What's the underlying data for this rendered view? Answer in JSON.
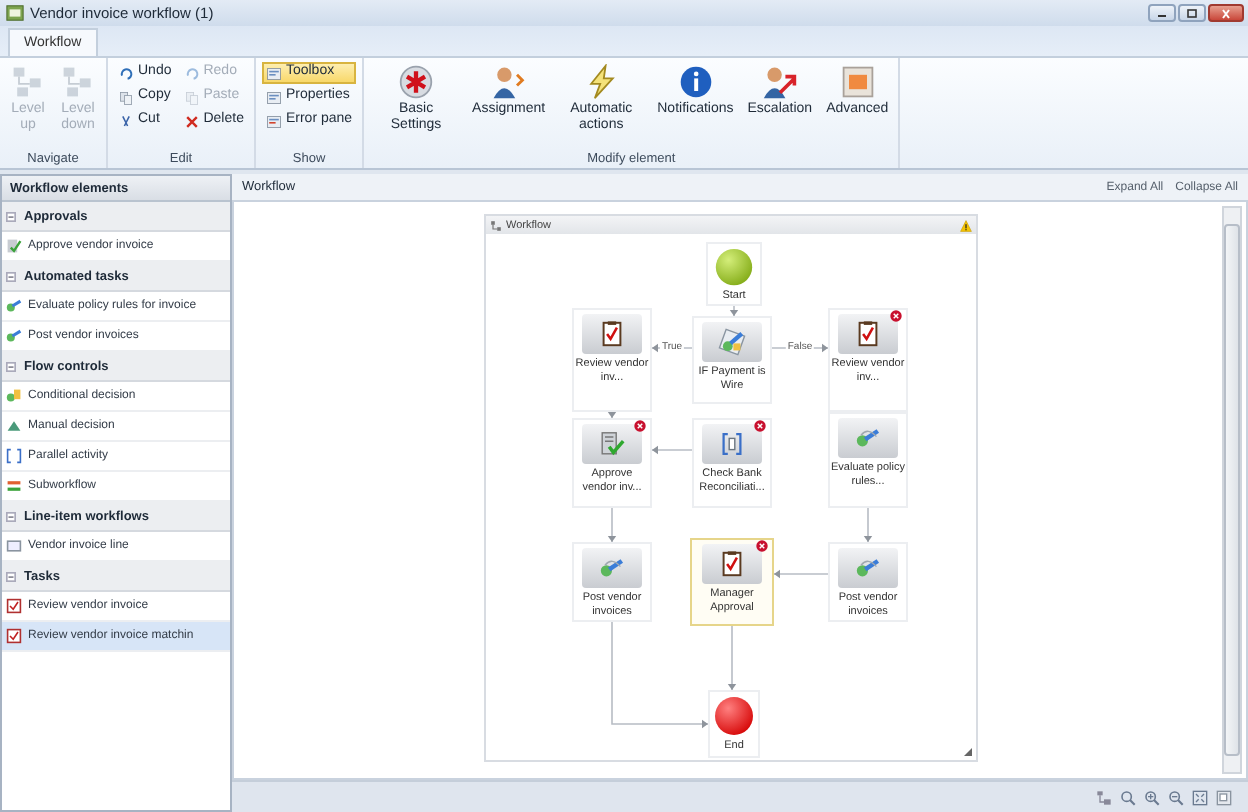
{
  "window": {
    "title": "Vendor invoice workflow (1)"
  },
  "tabs": [
    {
      "label": "Workflow",
      "selected": true
    }
  ],
  "ribbon": {
    "groups": [
      {
        "label": "Navigate",
        "kind": "large",
        "buttons": [
          {
            "label": "Level up",
            "disabled": true,
            "on": false
          },
          {
            "label": "Level down",
            "disabled": true,
            "on": false
          }
        ]
      },
      {
        "label": "Edit",
        "kind": "small",
        "buttons": [
          {
            "label": "Undo",
            "disabled": false,
            "on": false
          },
          {
            "label": "Redo",
            "disabled": true,
            "on": false
          },
          {
            "label": "Copy",
            "disabled": false,
            "on": false
          },
          {
            "label": "Paste",
            "disabled": true,
            "on": false
          },
          {
            "label": "Cut",
            "disabled": false,
            "on": false
          },
          {
            "label": "Delete",
            "disabled": false,
            "on": false
          }
        ]
      },
      {
        "label": "Show",
        "kind": "small",
        "buttons": [
          {
            "label": "Toolbox",
            "disabled": false,
            "on": true
          },
          {
            "label": "Properties",
            "disabled": false,
            "on": false
          },
          {
            "label": "Error pane",
            "disabled": false,
            "on": false
          }
        ]
      },
      {
        "label": "Modify element",
        "kind": "large",
        "buttons": [
          {
            "label": "Basic Settings",
            "disabled": false,
            "on": false
          },
          {
            "label": "Assignment",
            "disabled": false,
            "on": false
          },
          {
            "label": "Automatic actions",
            "disabled": false,
            "on": false
          },
          {
            "label": "Notifications",
            "disabled": false,
            "on": false
          },
          {
            "label": "Escalation",
            "disabled": false,
            "on": false
          },
          {
            "label": "Advanced",
            "disabled": false,
            "on": false
          }
        ]
      }
    ]
  },
  "panel": {
    "title": "Workflow elements",
    "sections": [
      {
        "title": "Approvals",
        "expanded": true,
        "items": [
          {
            "label": "Approve vendor invoice",
            "kind": "approval",
            "selected": false
          }
        ]
      },
      {
        "title": "Automated tasks",
        "expanded": true,
        "items": [
          {
            "label": "Evaluate policy rules for invoice",
            "kind": "automated",
            "selected": false
          },
          {
            "label": "Post vendor invoices",
            "kind": "automated",
            "selected": false
          }
        ]
      },
      {
        "title": "Flow controls",
        "expanded": true,
        "items": [
          {
            "label": "Conditional decision",
            "kind": "decision",
            "selected": false
          },
          {
            "label": "Manual decision",
            "kind": "manual",
            "selected": false
          },
          {
            "label": "Parallel activity",
            "kind": "parallel",
            "selected": false
          },
          {
            "label": "Subworkflow",
            "kind": "subworkflow",
            "selected": false
          }
        ]
      },
      {
        "title": "Line-item workflows",
        "expanded": true,
        "items": [
          {
            "label": "Vendor invoice line",
            "kind": "line",
            "selected": false
          }
        ]
      },
      {
        "title": "Tasks",
        "expanded": true,
        "items": [
          {
            "label": "Review vendor invoice",
            "kind": "task",
            "selected": false
          },
          {
            "label": "Review vendor invoice matchin",
            "kind": "task",
            "selected": true
          }
        ]
      }
    ]
  },
  "canvas": {
    "title": "Workflow",
    "links": [
      "Expand All",
      "Collapse All"
    ]
  },
  "diagram": {
    "title": "Workflow",
    "warning": true,
    "nodes": [
      {
        "label": "Start",
        "kind": "start",
        "error": false,
        "selected": false
      },
      {
        "label": "Review vendor inv...",
        "kind": "task",
        "error": false,
        "selected": false
      },
      {
        "label": "IF Payment is Wire",
        "kind": "decision",
        "error": false,
        "selected": false
      },
      {
        "label": "Review vendor inv...",
        "kind": "task",
        "error": true,
        "selected": false
      },
      {
        "label": "Approve vendor inv...",
        "kind": "approval",
        "error": true,
        "selected": false
      },
      {
        "label": "Check Bank Reconciliati...",
        "kind": "subworkflow",
        "error": true,
        "selected": false
      },
      {
        "label": "Evaluate policy rules...",
        "kind": "automated",
        "error": false,
        "selected": false
      },
      {
        "label": "Post vendor invoices",
        "kind": "automated",
        "error": false,
        "selected": false
      },
      {
        "label": "Manager Approval",
        "kind": "task",
        "error": true,
        "selected": true
      },
      {
        "label": "Post vendor invoices",
        "kind": "automated",
        "error": false,
        "selected": false
      },
      {
        "label": "End",
        "kind": "end",
        "error": false,
        "selected": false
      }
    ],
    "edge_labels": [
      "True",
      "False"
    ]
  }
}
